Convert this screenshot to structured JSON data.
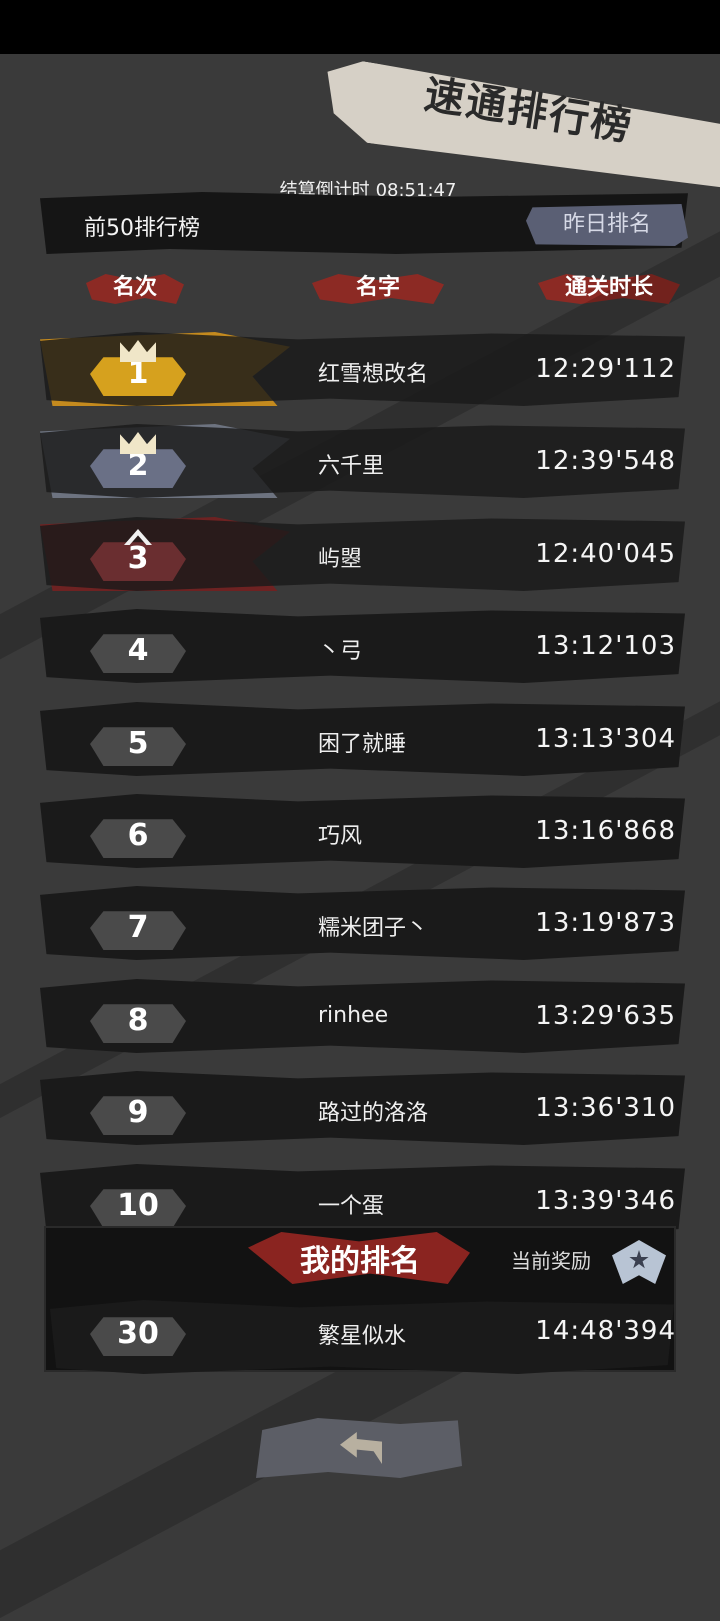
{
  "title": "速通排行榜",
  "countdown": {
    "label": "结算倒计时",
    "value": "08:51:47"
  },
  "board_label": "前50排行榜",
  "yesterday_button": "昨日排名",
  "columns": {
    "rank": "名次",
    "name": "名字",
    "time": "通关时长"
  },
  "rows": [
    {
      "rank": "1",
      "name": "红雪想改名",
      "time": "12:29'112",
      "tier": "gold"
    },
    {
      "rank": "2",
      "name": "六千里",
      "time": "12:39'548",
      "tier": "silver"
    },
    {
      "rank": "3",
      "name": "屿曌",
      "time": "12:40'045",
      "tier": "bronze"
    },
    {
      "rank": "4",
      "name": "丶弓",
      "time": "13:12'103",
      "tier": "normal"
    },
    {
      "rank": "5",
      "name": "困了就睡",
      "time": "13:13'304",
      "tier": "normal"
    },
    {
      "rank": "6",
      "name": "巧风",
      "time": "13:16'868",
      "tier": "normal"
    },
    {
      "rank": "7",
      "name": "糯米团子丶",
      "time": "13:19'873",
      "tier": "normal"
    },
    {
      "rank": "8",
      "name": "rinhee",
      "time": "13:29'635",
      "tier": "normal"
    },
    {
      "rank": "9",
      "name": "路过的洛洛",
      "time": "13:36'310",
      "tier": "normal"
    },
    {
      "rank": "10",
      "name": "一个蛋",
      "time": "13:39'346",
      "tier": "normal"
    }
  ],
  "my_rank": {
    "title": "我的排名",
    "reward_label": "当前奖励",
    "rank": "30",
    "name": "繁星似水",
    "time": "14:48'394"
  },
  "icons": {
    "back": "back-arrow-icon",
    "reward": "reward-medal-icon",
    "crown": "crown-icon"
  },
  "colors": {
    "gold": "#d6a11e",
    "silver": "#6a7086",
    "bronze": "#6a2e30",
    "accent_red": "#8c2a24"
  }
}
